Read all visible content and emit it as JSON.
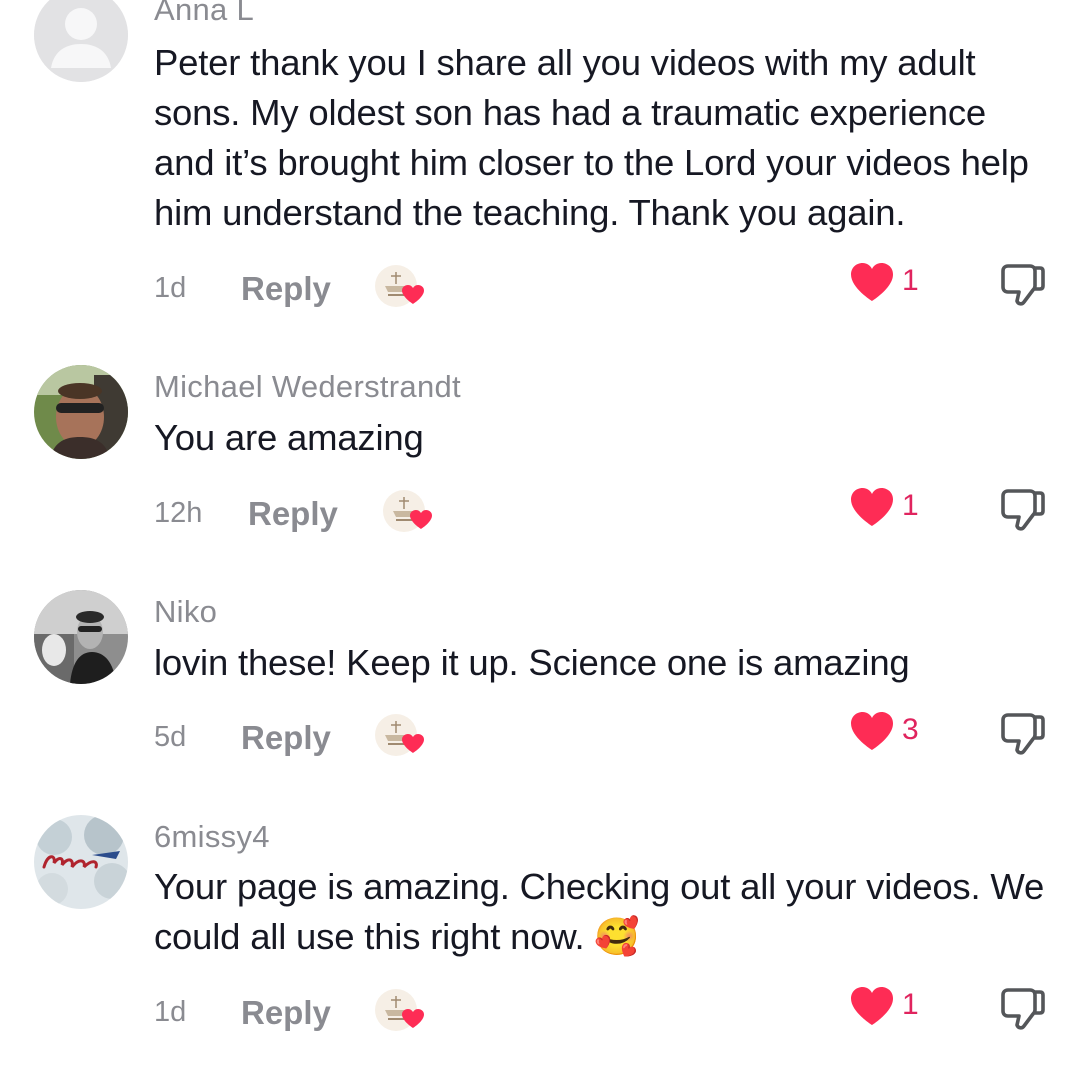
{
  "comments": [
    {
      "username": "Anna L",
      "text": "Peter thank you I share all you videos with my adult sons. My oldest son has had a traumatic experience and it’s brought him closer to the Lord your videos help him understand the teaching. Thank you again.",
      "time": "1d",
      "reply_label": "Reply",
      "likes": "1",
      "avatar_icon": "default-avatar-icon"
    },
    {
      "username": "Michael Wederstrandt",
      "text": "You are amazing",
      "time": "12h",
      "reply_label": "Reply",
      "likes": "1",
      "avatar_icon": "user-photo-avatar"
    },
    {
      "username": "Niko",
      "text": "lovin these! Keep it up. Science one is amazing",
      "time": "5d",
      "reply_label": "Reply",
      "likes": "3",
      "avatar_icon": "user-photo-avatar"
    },
    {
      "username": "6missy4",
      "text": "Your page is amazing. Checking out all your videos. We could all use this right now. 🥰",
      "time": "1d",
      "reply_label": "Reply",
      "likes": "1",
      "avatar_icon": "buffalo-avatar"
    }
  ],
  "colors": {
    "like_red": "#fe2c55",
    "like_count": "#e0245e",
    "muted_gray": "#8a8b91",
    "text": "#161823"
  },
  "icons": {
    "like": "heart-icon",
    "dislike": "thumbs-down-icon",
    "creator_liked": "creator-liked-badge-icon"
  }
}
